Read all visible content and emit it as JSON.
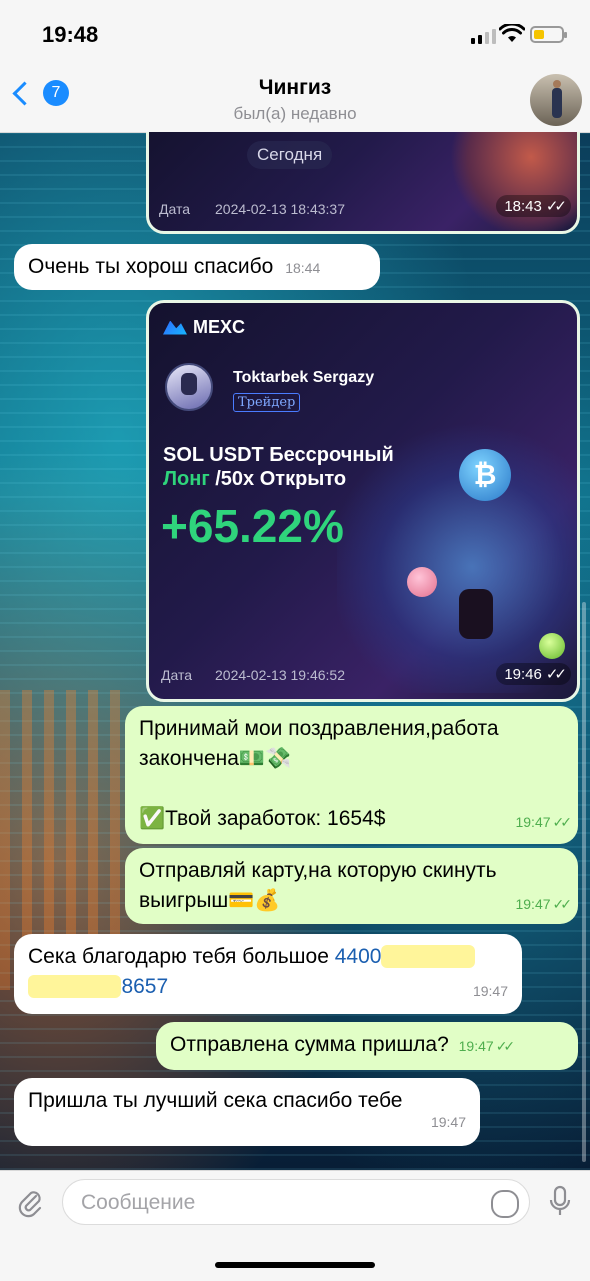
{
  "status_bar": {
    "time": "19:48"
  },
  "header": {
    "back_badge": "7",
    "title": "Чингиз",
    "subtitle": "был(а) недавно"
  },
  "messages": {
    "media1": {
      "today_label": "Сегодня",
      "date_label": "Дата",
      "date_value": "2024-02-13 18:43:37",
      "time": "18:43"
    },
    "msg1": {
      "text": "Очень ты хорош спасибо",
      "time": "18:44"
    },
    "media2": {
      "brand": "MEXC",
      "trader_name": "Toktarbek Sergazy",
      "trader_tag": "Трейдер",
      "pair_line1": "SOL USDT Бессрочный",
      "pair_long": "Лонг",
      "pair_rest": " /50x Открыто",
      "pnl": "+65.22%",
      "date_label": "Дата",
      "date_value": "2024-02-13 19:46:52",
      "time": "19:46"
    },
    "msg2": {
      "line1": "Принимай мои поздравления,работа",
      "line2": "закончена💵💸",
      "line3": "✅Твой заработок: 1654$",
      "time": "19:47"
    },
    "msg3": {
      "line1": "Отправляй карту,на которую скинуть",
      "line2": "выигрыш💳💰",
      "time": "19:47"
    },
    "msg4": {
      "prefix": "Сека благодарю тебя большое ",
      "card_start": "4400",
      "card_end": "8657",
      "time": "19:47"
    },
    "msg5": {
      "text": "Отправлена сумма пришла?",
      "time": "19:47"
    },
    "msg6": {
      "text": "Пришла ты лучший сека спасибо тебе",
      "time": "19:47"
    }
  },
  "composer": {
    "placeholder": "Сообщение"
  },
  "colors": {
    "accent": "#1a8cff",
    "outgoing_bubble": "#e1fec6",
    "incoming_bubble": "#ffffff",
    "pnl_green": "#2fd47c"
  }
}
